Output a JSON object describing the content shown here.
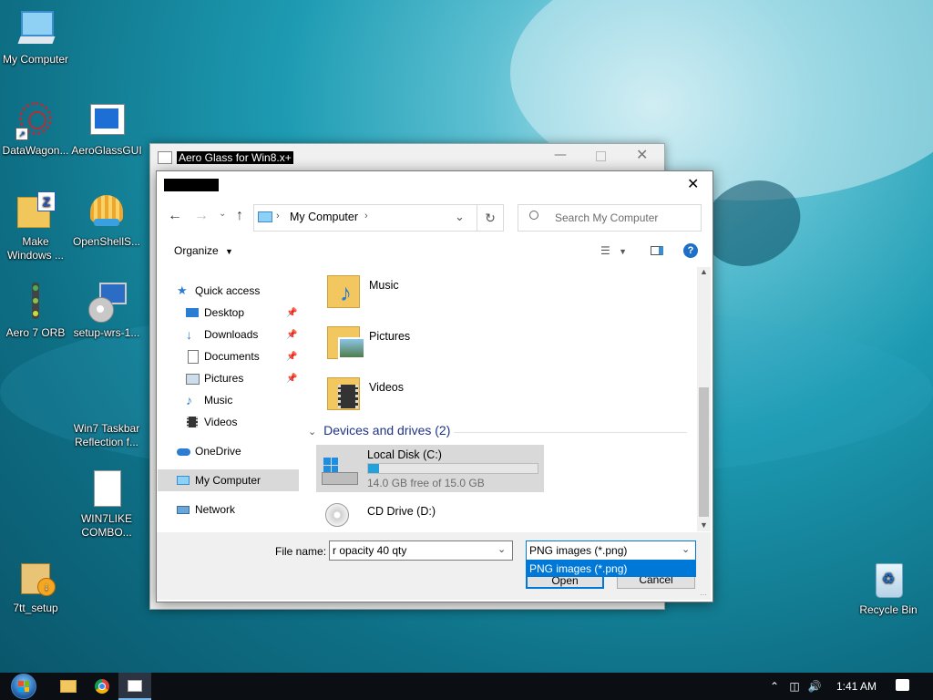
{
  "desktop": {
    "icons": [
      {
        "label": "My Computer"
      },
      {
        "label": "DataWagon..."
      },
      {
        "label": "AeroGlassGUI"
      },
      {
        "label_line1": "Make",
        "label_line2": "Windows ..."
      },
      {
        "label": "OpenShellS..."
      },
      {
        "label": "Aero 7 ORB"
      },
      {
        "label": "setup-wrs-1..."
      },
      {
        "label_line1": "Win7 Taskbar",
        "label_line2": "Reflection f..."
      },
      {
        "label_line1": "WIN7LIKE",
        "label_line2": "COMBO..."
      },
      {
        "label": "7tt_setup"
      },
      {
        "label": "Recycle Bin"
      }
    ]
  },
  "back_window": {
    "title": "Aero Glass for Win8.x+"
  },
  "dialog": {
    "address": {
      "root": "My Computer"
    },
    "search": {
      "placeholder": "Search My Computer"
    },
    "toolbar": {
      "organize": "Organize"
    },
    "nav": {
      "quick_access": "Quick access",
      "items": [
        "Desktop",
        "Downloads",
        "Documents",
        "Pictures",
        "Music",
        "Videos"
      ],
      "onedrive": "OneDrive",
      "my_computer": "My Computer",
      "network": "Network"
    },
    "folders": [
      "Music",
      "Pictures",
      "Videos"
    ],
    "devices_header": "Devices and drives (2)",
    "drives": [
      {
        "name": "Local Disk (C:)",
        "free": "14.0 GB free of 15.0 GB",
        "used_fraction": 0.0667
      },
      {
        "name": "CD Drive (D:)"
      }
    ],
    "filename_label": "File name:",
    "filename_value": "r opacity 40 qty",
    "filetype_value": "PNG images (*.png)",
    "filetype_option": "PNG images (*.png)",
    "open_label": "Open",
    "cancel_label": "Cancel"
  },
  "taskbar": {
    "clock": "1:41 AM"
  },
  "colors": {
    "accent": "#0078d7",
    "selection": "#cce8ff",
    "dropdown_highlight": "#0078d7"
  }
}
